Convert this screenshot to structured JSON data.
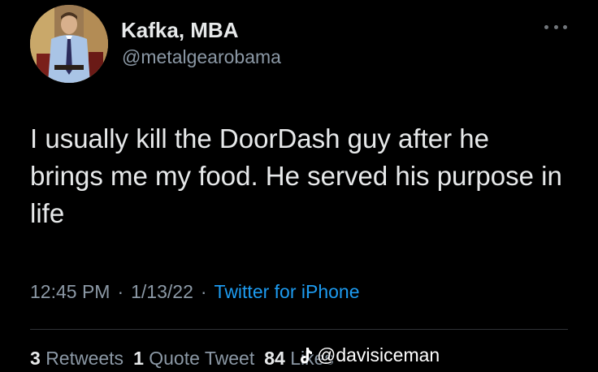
{
  "user": {
    "display_name": "Kafka, MBA",
    "handle": "@metalgearobama"
  },
  "tweet": {
    "text": "I usually kill the DoorDash guy after he brings me my food. He served his purpose in life",
    "time": "12:45 PM",
    "date": "1/13/22",
    "separator": "·",
    "source": "Twitter for iPhone"
  },
  "stats": {
    "retweets_count": "3",
    "retweets_label": "Retweets",
    "quote_count": "1",
    "quote_label": "Quote Tweet",
    "likes_count": "84",
    "likes_label": "Likes"
  },
  "watermark": {
    "icon": "tiktok-icon",
    "text": "@davisiceman"
  },
  "colors": {
    "background": "#000000",
    "primary_text": "#e7e9ea",
    "secondary_text": "#8b98a5",
    "link": "#1d9bf0"
  }
}
